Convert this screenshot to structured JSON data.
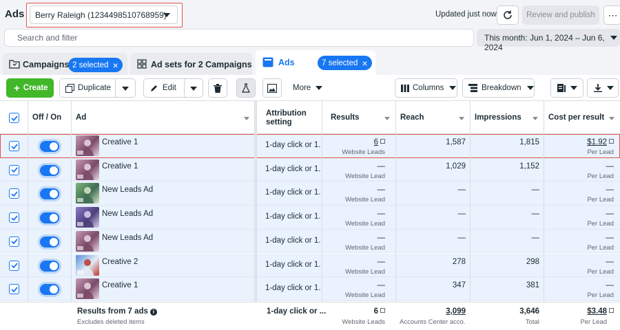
{
  "app": {
    "title": "Ads",
    "account": "Berry Raleigh (1234498510768959)",
    "updated": "Updated just now",
    "review_publish": "Review and publish",
    "more_dots": "⋯"
  },
  "search": {
    "placeholder": "Search and filter"
  },
  "date_range": {
    "label": "This month: Jun 1, 2024 – Jun 6, 2024"
  },
  "tabs": {
    "campaigns": {
      "label": "Campaigns",
      "selected": "2 selected"
    },
    "adsets": {
      "label": "Ad sets for 2 Campaigns"
    },
    "ads": {
      "label": "Ads",
      "selected": "7 selected"
    }
  },
  "toolbar": {
    "create": "Create",
    "duplicate": "Duplicate",
    "edit": "Edit",
    "more": "More",
    "columns": "Columns",
    "breakdown": "Breakdown"
  },
  "table": {
    "headers": {
      "off_on": "Off / On",
      "ad": "Ad",
      "attribution_1": "Attribution",
      "attribution_2": "setting",
      "results": "Results",
      "reach": "Reach",
      "impressions": "Impressions",
      "cost": "Cost per result"
    },
    "rows": [
      {
        "name": "Creative 1",
        "attribution": "1-day click or 1...",
        "results": "6",
        "results_sub": "Website Leads",
        "reach": "1,587",
        "impressions": "1,815",
        "cost": "$1.92",
        "cost_sub": "Per Lead",
        "thumb": "pink"
      },
      {
        "name": "Creative 1",
        "attribution": "1-day click or 1...",
        "results": "—",
        "results_sub": "Website Lead",
        "reach": "1,029",
        "impressions": "1,152",
        "cost": "—",
        "cost_sub": "Per Lead",
        "thumb": "pink"
      },
      {
        "name": "New Leads Ad",
        "attribution": "1-day click or 1...",
        "results": "—",
        "results_sub": "Website Lead",
        "reach": "—",
        "impressions": "—",
        "cost": "—",
        "cost_sub": "Per Lead",
        "thumb": "green"
      },
      {
        "name": "New Leads Ad",
        "attribution": "1-day click or 1...",
        "results": "—",
        "results_sub": "Website Lead",
        "reach": "—",
        "impressions": "—",
        "cost": "—",
        "cost_sub": "Per Lead",
        "thumb": "purple"
      },
      {
        "name": "New Leads Ad",
        "attribution": "1-day click or 1...",
        "results": "—",
        "results_sub": "Website Lead",
        "reach": "—",
        "impressions": "—",
        "cost": "—",
        "cost_sub": "Per Lead",
        "thumb": "pink"
      },
      {
        "name": "Creative 2",
        "attribution": "1-day click or 1...",
        "results": "—",
        "results_sub": "Website Lead",
        "reach": "278",
        "impressions": "298",
        "cost": "—",
        "cost_sub": "Per Lead",
        "thumb": "blue"
      },
      {
        "name": "Creative 1",
        "attribution": "1-day click or 1...",
        "results": "—",
        "results_sub": "Website Lead",
        "reach": "347",
        "impressions": "381",
        "cost": "—",
        "cost_sub": "Per Lead",
        "thumb": "pink"
      }
    ],
    "footer": {
      "title": "Results from 7 ads",
      "subtitle": "Excludes deleted items",
      "attribution": "1-day click or ...",
      "results": "6",
      "results_sub": "Website Leads",
      "reach": "3,099",
      "reach_sub": "Accounts Center acco...",
      "impressions": "3,646",
      "impressions_sub": "Total",
      "cost": "$3.48",
      "cost_sub": "Per Lead"
    }
  },
  "colors": {
    "accent": "#1877f2",
    "create": "#42b72a",
    "highlight": "#e05252",
    "row_bg": "#e9f2fd"
  }
}
